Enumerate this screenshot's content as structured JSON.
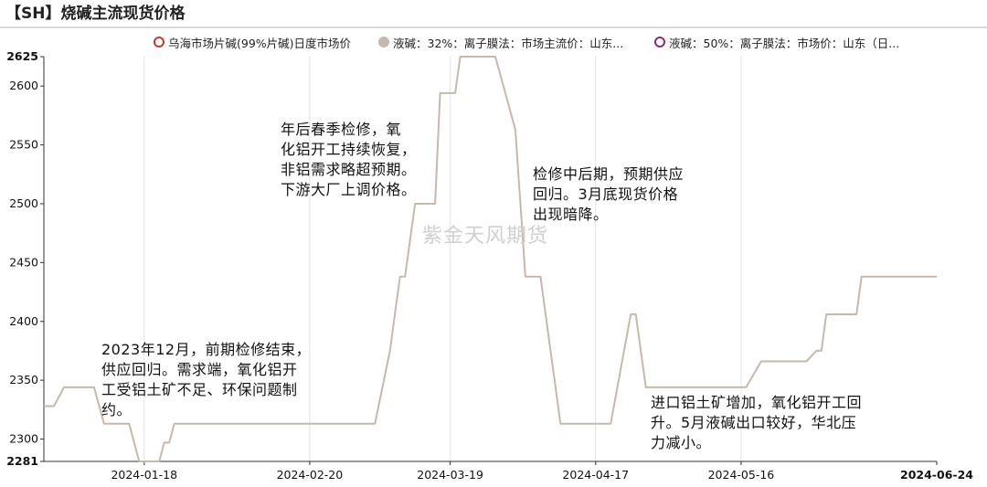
{
  "title": "【SH】烧碱主流现货价格",
  "watermark": "紫金天风期货",
  "legend": [
    {
      "label": "乌海市场片碱(99%片碱)日度市场价",
      "color": "#c0392b",
      "style": "hollow"
    },
    {
      "label": "液碱：32%：离子膜法：市场主流价：山东...",
      "color": "#c5b9ab",
      "style": "filled"
    },
    {
      "label": "液碱：50%：离子膜法：市场价：山东（日...",
      "color": "#8e2a6b",
      "style": "hollow"
    }
  ],
  "annotations": [
    {
      "text": "年后春季检修，氧\n化铝开工持续恢复，\n非铝需求略超预期。\n下游大厂上调价格。"
    },
    {
      "text": "检修中后期，预期供应\n回归。3月底现货价格\n出现暗降。"
    },
    {
      "text": "2023年12月，前期检修结束，\n供应回归。需求端，氧化铝开\n工受铝土矿不足、环保问题制\n约。"
    },
    {
      "text": "进口铝土矿增加，氧化铝开工回\n升。5月液碱出口较好，华北压\n力减小。"
    }
  ],
  "chart_data": {
    "type": "line",
    "title": "【SH】烧碱主流现货价格",
    "xlabel": "",
    "ylabel": "",
    "ylim": [
      2281,
      2625
    ],
    "yticks": [
      2281,
      2300,
      2350,
      2400,
      2450,
      2500,
      2550,
      2600,
      2625
    ],
    "ytick_bold": [
      2281,
      2625
    ],
    "xlim": [
      "2023-12-29",
      "2024-06-24"
    ],
    "xticks": [
      "2024-01-18",
      "2024-02-20",
      "2024-03-19",
      "2024-04-17",
      "2024-05-16",
      "2024-06-24"
    ],
    "xtick_bold": [
      "2024-06-24"
    ],
    "grid": "vertical",
    "series": [
      {
        "name": "液碱：32%：离子膜法：市场主流价：山东...",
        "color": "#c5b9ab",
        "points": [
          [
            "2023-12-29",
            2328
          ],
          [
            "2023-12-31",
            2328
          ],
          [
            "2024-01-02",
            2344
          ],
          [
            "2024-01-08",
            2344
          ],
          [
            "2024-01-10",
            2313
          ],
          [
            "2024-01-15",
            2313
          ],
          [
            "2024-01-17",
            2281
          ],
          [
            "2024-01-21",
            2281
          ],
          [
            "2024-01-22",
            2297
          ],
          [
            "2024-01-23",
            2297
          ],
          [
            "2024-01-24",
            2313
          ],
          [
            "2024-03-04",
            2313
          ],
          [
            "2024-03-07",
            2375
          ],
          [
            "2024-03-09",
            2438
          ],
          [
            "2024-03-10",
            2438
          ],
          [
            "2024-03-12",
            2500
          ],
          [
            "2024-03-16",
            2500
          ],
          [
            "2024-03-17",
            2594
          ],
          [
            "2024-03-20",
            2594
          ],
          [
            "2024-03-21",
            2625
          ],
          [
            "2024-03-28",
            2625
          ],
          [
            "2024-04-01",
            2563
          ],
          [
            "2024-04-03",
            2438
          ],
          [
            "2024-04-06",
            2438
          ],
          [
            "2024-04-10",
            2313
          ],
          [
            "2024-04-20",
            2313
          ],
          [
            "2024-04-24",
            2406
          ],
          [
            "2024-04-25",
            2406
          ],
          [
            "2024-04-27",
            2344
          ],
          [
            "2024-05-17",
            2344
          ],
          [
            "2024-05-20",
            2366
          ],
          [
            "2024-05-29",
            2366
          ],
          [
            "2024-05-31",
            2375
          ],
          [
            "2024-06-01",
            2375
          ],
          [
            "2024-06-02",
            2406
          ],
          [
            "2024-06-08",
            2406
          ],
          [
            "2024-06-09",
            2438
          ],
          [
            "2024-06-24",
            2438
          ]
        ]
      }
    ]
  }
}
